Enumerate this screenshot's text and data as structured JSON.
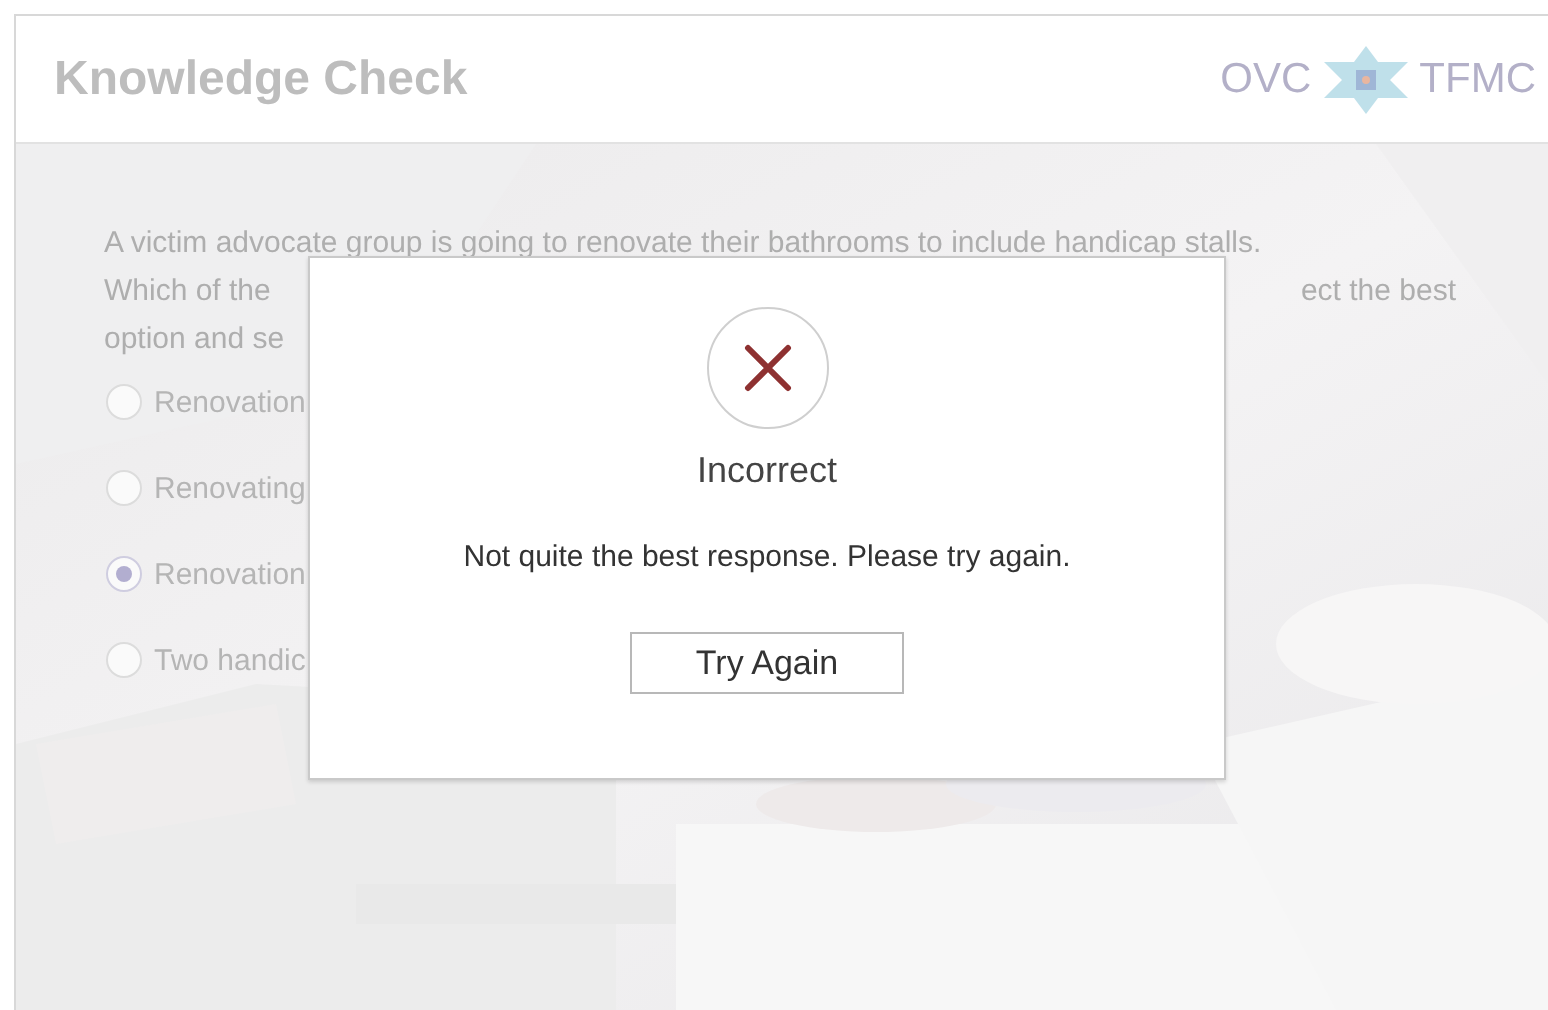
{
  "header": {
    "title": "Knowledge Check",
    "logo": {
      "left_text": "OVC",
      "right_text": "TFMC"
    }
  },
  "question": {
    "lines": [
      [
        "A victim advocate group is going to renovate their bathrooms to include handicap stalls."
      ],
      [
        "Which of the",
        "ect the best"
      ],
      [
        "option and se"
      ]
    ]
  },
  "options": [
    {
      "label": "Renovation",
      "selected": false
    },
    {
      "label": "Renovating",
      "selected": false
    },
    {
      "label": "Renovation",
      "selected": true
    },
    {
      "label": "Two handic",
      "selected": false
    }
  ],
  "dialog": {
    "title": "Incorrect",
    "message": "Not quite the best response. Please try again.",
    "button": "Try Again"
  }
}
